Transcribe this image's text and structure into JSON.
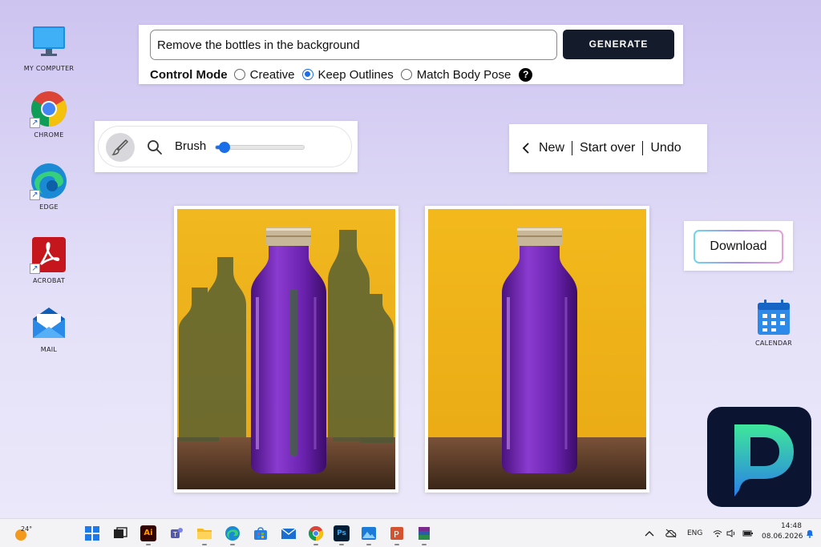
{
  "desktop": {
    "icons": [
      {
        "label": "MY COMPUTER",
        "icon": "monitor-icon"
      },
      {
        "label": "CHROME",
        "icon": "chrome-icon"
      },
      {
        "label": "EDGE",
        "icon": "edge-icon"
      },
      {
        "label": "ACROBAT",
        "icon": "acrobat-icon"
      },
      {
        "label": "MAIL",
        "icon": "mail-icon"
      },
      {
        "label": "CALENDAR",
        "icon": "calendar-icon"
      }
    ]
  },
  "prompt": {
    "value": "Remove the bottles in the background",
    "generate_label": "GENERATE"
  },
  "control_mode": {
    "title": "Control Mode",
    "options": [
      {
        "label": "Creative",
        "selected": false
      },
      {
        "label": "Keep Outlines",
        "selected": true
      },
      {
        "label": "Match Body Pose",
        "selected": false
      }
    ],
    "help_label": "?"
  },
  "brush": {
    "label": "Brush",
    "size_fraction": 0.1
  },
  "actions": {
    "new_label": "New",
    "start_over_label": "Start over",
    "undo_label": "Undo"
  },
  "download": {
    "label": "Download"
  },
  "colors": {
    "accent": "#1a6fe8",
    "generate_bg": "#141c2c",
    "backdrop_yellow": "#f2b71d",
    "bottle_purple": "#7a2fc0"
  },
  "taskbar": {
    "weather_temp": "24°",
    "lang": "ENG",
    "time": "14:48",
    "date": "08.06.2026"
  }
}
